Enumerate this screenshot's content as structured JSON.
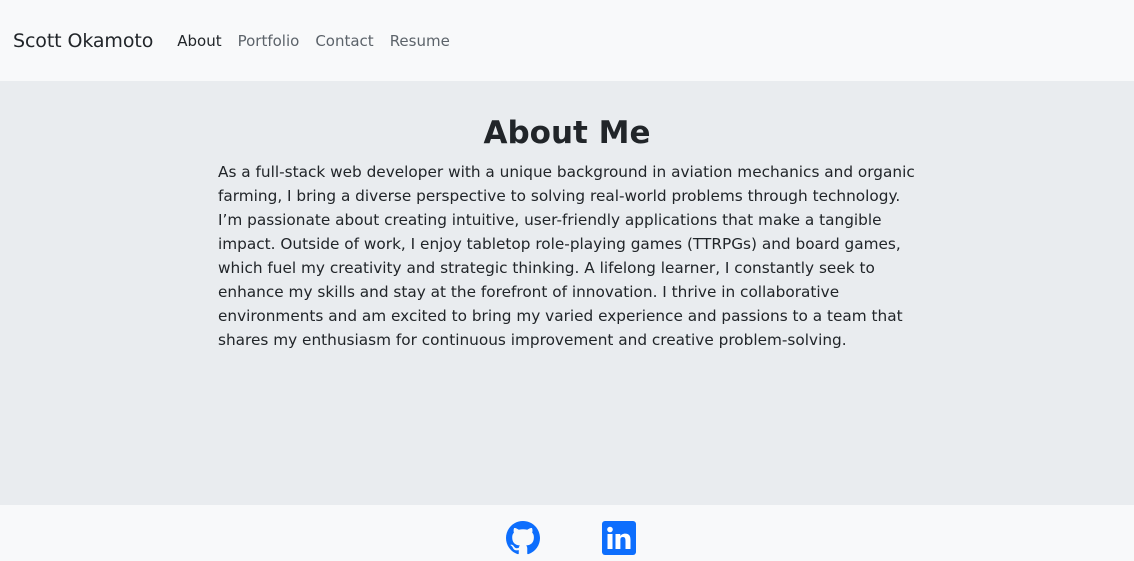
{
  "navbar": {
    "brand": "Scott Okamoto",
    "links": [
      {
        "label": "About",
        "active": true
      },
      {
        "label": "Portfolio",
        "active": false
      },
      {
        "label": "Contact",
        "active": false
      },
      {
        "label": "Resume",
        "active": false
      }
    ]
  },
  "about": {
    "title": "About Me",
    "body": "As a full-stack web developer with a unique background in aviation mechanics and organic farming, I bring a diverse perspective to solving real-world problems through technology. I’m passionate about creating intuitive, user-friendly applications that make a tangible impact. Outside of work, I enjoy tabletop role-playing games (TTRPGs) and board games, which fuel my creativity and strategic thinking. A lifelong learner, I constantly seek to enhance my skills and stay at the forefront of innovation. I thrive in collaborative environments and am excited to bring my varied experience and passions to a team that shares my enthusiasm for continuous improvement and creative problem-solving."
  },
  "footer": {
    "icons": [
      "github-icon",
      "linkedin-icon"
    ]
  },
  "colors": {
    "navbar_bg": "#f8f9fa",
    "main_bg": "#e9ecef",
    "text": "#212529",
    "nav_muted": "#5c636a",
    "icon_blue": "#0d6efd"
  }
}
